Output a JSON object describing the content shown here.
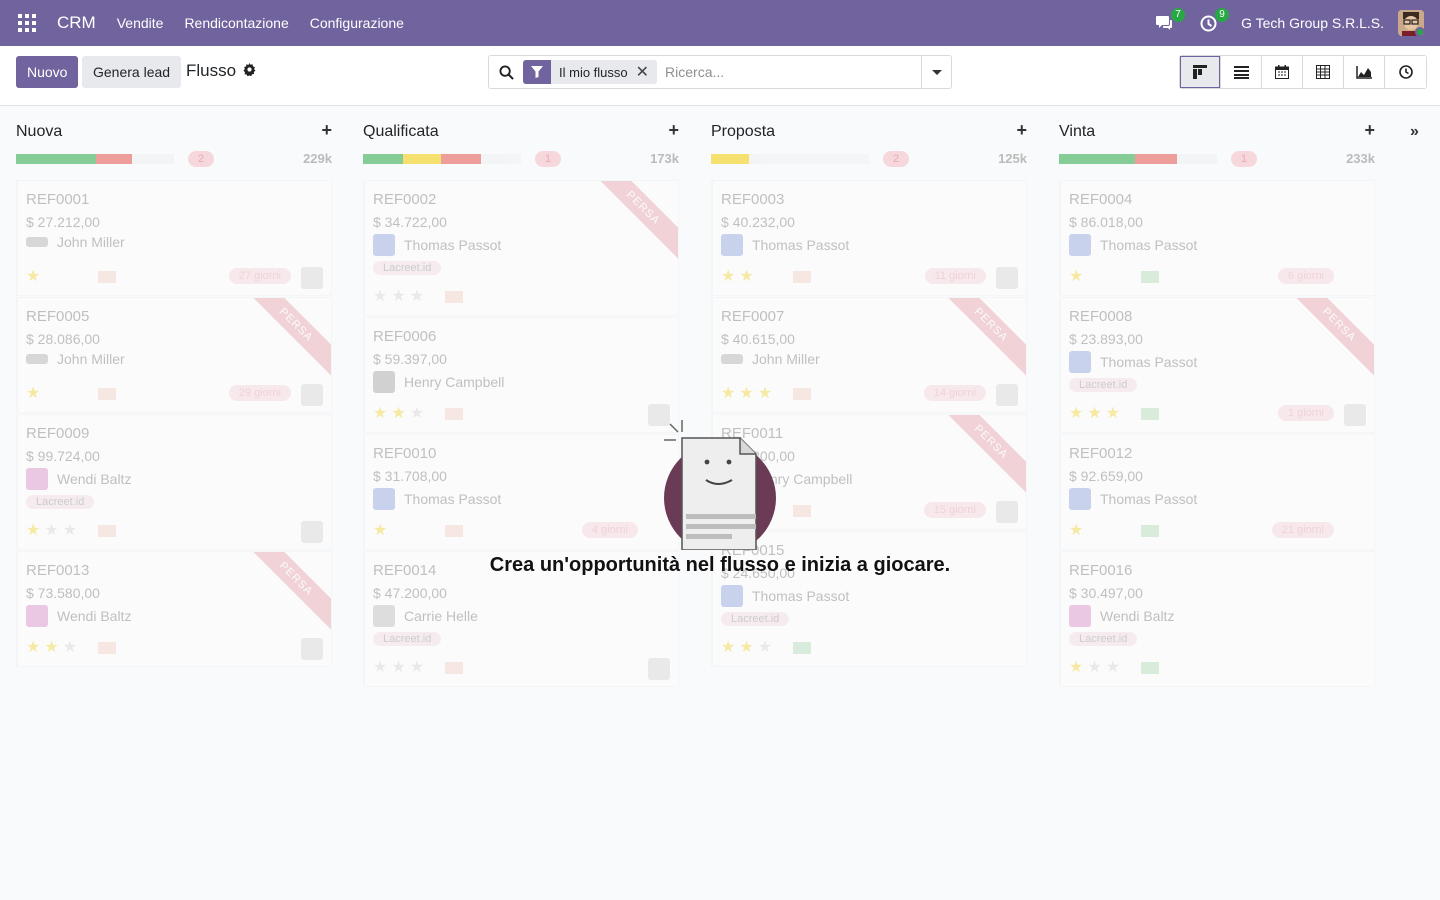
{
  "navbar": {
    "app_name": "CRM",
    "menu": [
      "Vendite",
      "Rendicontazione",
      "Configurazione"
    ],
    "messages_count": "7",
    "activities_count": "9",
    "company": "G Tech Group S.R.L.S."
  },
  "control": {
    "new_label": "Nuovo",
    "generate_label": "Genera lead",
    "breadcrumb": "Flusso",
    "facet_label": "Il mio flusso",
    "search_placeholder": "Ricerca..."
  },
  "columns": [
    {
      "title": "Nuova",
      "count": "2",
      "sum": "229k"
    },
    {
      "title": "Qualificata",
      "count": "1",
      "sum": "173k"
    },
    {
      "title": "Proposta",
      "count": "2",
      "sum": "125k"
    },
    {
      "title": "Vinta",
      "count": "1",
      "sum": "233k"
    }
  ],
  "cards": {
    "c1": {
      "ref": "REF0001",
      "amount": "$ 27.212,00",
      "person": "John Miller",
      "days": "27 giorni"
    },
    "c5": {
      "ref": "REF0005",
      "amount": "$ 28.086,00",
      "person": "John Miller",
      "days": "29 giorni",
      "ribbon": "PERSA"
    },
    "c9": {
      "ref": "REF0009",
      "amount": "$ 99.724,00",
      "person": "Wendi Baltz",
      "tag": "Lacreet.id"
    },
    "c13": {
      "ref": "REF0013",
      "amount": "$ 73.580,00",
      "person": "Wendi Baltz",
      "ribbon": "PERSA"
    },
    "c2": {
      "ref": "REF0002",
      "amount": "$ 34.722,00",
      "person": "Thomas Passot",
      "tag": "Lacreet.id",
      "ribbon": "PERSA"
    },
    "c6": {
      "ref": "REF0006",
      "amount": "$ 59.397,00",
      "person": "Henry Campbell"
    },
    "c10": {
      "ref": "REF0010",
      "amount": "$ 31.708,00",
      "person": "Thomas Passot",
      "days": "4 giorni"
    },
    "c14": {
      "ref": "REF0014",
      "amount": "$ 47.200,00",
      "person": "Carrie Helle",
      "tag": "Lacreet.id"
    },
    "c3": {
      "ref": "REF0003",
      "amount": "$ 40.232,00",
      "person": "Thomas Passot",
      "days": "11 giorni"
    },
    "c7": {
      "ref": "REF0007",
      "amount": "$ 40.615,00",
      "person": "John Miller",
      "days": "14 giorni",
      "ribbon": "PERSA"
    },
    "c11": {
      "ref": "REF0011",
      "amount": "$ 19.800,00",
      "person": "Henry Campbell",
      "days": "15 giorni",
      "ribbon": "PERSA"
    },
    "c15": {
      "ref": "REF0015",
      "amount": "$ 24.650,00",
      "person": "Thomas Passot",
      "tag": "Lacreet.id"
    },
    "c4": {
      "ref": "REF0004",
      "amount": "$ 86.018,00",
      "person": "Thomas Passot",
      "days": "6 giorni"
    },
    "c8": {
      "ref": "REF0008",
      "amount": "$ 23.893,00",
      "person": "Thomas Passot",
      "tag": "Lacreet.id",
      "days": "1 giorni",
      "ribbon": "PERSA"
    },
    "c12": {
      "ref": "REF0012",
      "amount": "$ 92.659,00",
      "person": "Thomas Passot",
      "days": "21 giorni"
    },
    "c16": {
      "ref": "REF0016",
      "amount": "$ 30.497,00",
      "person": "Wendi Baltz",
      "tag": "Lacreet.id"
    }
  },
  "helper": {
    "text": "Crea un'opportunità nel flusso e inizia a giocare."
  },
  "colors": {
    "brand": "#71639e",
    "success": "#28a745",
    "danger_soft": "#f6c9cf"
  }
}
